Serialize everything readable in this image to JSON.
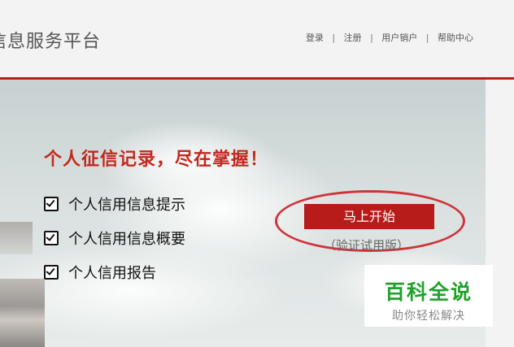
{
  "header": {
    "site_title": "信息服务平台",
    "links": [
      "登录",
      "注册",
      "用户销户",
      "帮助中心"
    ]
  },
  "banner": {
    "headline": "个人征信记录，尽在掌握！",
    "features": [
      "个人信用信息提示",
      "个人信用信息概要",
      "个人信用报告"
    ],
    "start_button": "马上开始",
    "trial_note": "（验证试用版）"
  },
  "watermark": {
    "main": "百科全说",
    "sub": "助你轻松解决"
  },
  "colors": {
    "accent_red": "#b71c1a",
    "headline_red": "#c4281f",
    "watermark_green": "#1fa22a"
  }
}
